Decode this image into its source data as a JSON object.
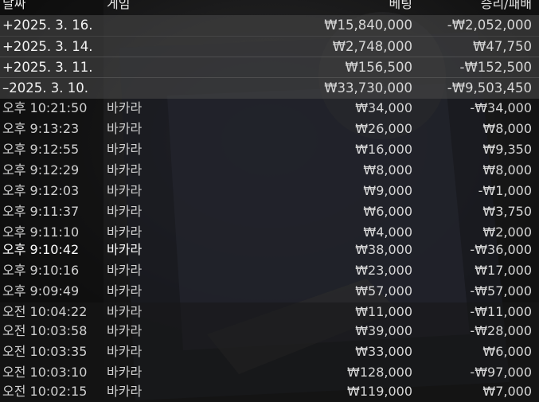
{
  "header": {
    "date": "날짜",
    "game": "게임",
    "bet": "베팅",
    "result": "승리/패배"
  },
  "days": [
    {
      "date": "+2025. 3. 16.",
      "bet": "₩15,840,000",
      "result": "-₩2,052,000"
    },
    {
      "date": "+2025. 3. 14.",
      "bet": "₩2,748,000",
      "result": "₩47,750"
    },
    {
      "date": "+2025. 3. 11.",
      "bet": "₩156,500",
      "result": "-₩152,500"
    },
    {
      "date": "–2025. 3. 10.",
      "bet": "₩33,730,000",
      "result": "-₩9,503,450"
    }
  ],
  "rounds": [
    {
      "time": "오후 10:21:50",
      "game": "바카라",
      "bet": "₩34,000",
      "result": "-₩34,000"
    },
    {
      "time": "오후 9:13:23",
      "game": "바카라",
      "bet": "₩26,000",
      "result": "₩8,000"
    },
    {
      "time": "오후 9:12:55",
      "game": "바카라",
      "bet": "₩16,000",
      "result": "₩9,350"
    },
    {
      "time": "오후 9:12:29",
      "game": "바카라",
      "bet": "₩8,000",
      "result": "₩8,000"
    },
    {
      "time": "오후 9:12:03",
      "game": "바카라",
      "bet": "₩9,000",
      "result": "-₩1,000"
    },
    {
      "time": "오후 9:11:37",
      "game": "바카라",
      "bet": "₩6,000",
      "result": "₩3,750"
    },
    {
      "time": "오후 9:11:10",
      "game": "바카라",
      "bet": "₩4,000",
      "result": "₩2,000"
    },
    {
      "time": "오후 9:10:42",
      "game": "바카라",
      "bet": "₩38,000",
      "result": "-₩36,000"
    },
    {
      "time": "오후 9:10:16",
      "game": "바카라",
      "bet": "₩23,000",
      "result": "₩17,000"
    },
    {
      "time": "오후 9:09:49",
      "game": "바카라",
      "bet": "₩57,000",
      "result": "-₩57,000"
    },
    {
      "time": "오전 10:04:22",
      "game": "바카라",
      "bet": "₩11,000",
      "result": "-₩11,000"
    },
    {
      "time": "오전 10:03:58",
      "game": "바카라",
      "bet": "₩39,000",
      "result": "-₩28,000"
    },
    {
      "time": "오전 10:03:35",
      "game": "바카라",
      "bet": "₩33,000",
      "result": "₩6,000"
    },
    {
      "time": "오전 10:03:10",
      "game": "바카라",
      "bet": "₩128,000",
      "result": "-₩97,000"
    },
    {
      "time": "오전 10:02:15",
      "game": "바카라",
      "bet": "₩119,000",
      "result": "₩7,000"
    }
  ]
}
